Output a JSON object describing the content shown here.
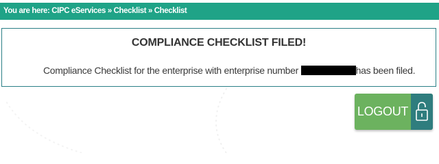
{
  "breadcrumb": {
    "prefix": "You are here:",
    "items": [
      "CIPC eServices",
      "Checklist",
      "Checklist"
    ],
    "separator": "»"
  },
  "panel": {
    "title": "COMPLIANCE CHECKLIST FILED!",
    "message_before": "Compliance Checklist for the enterprise with enterprise number",
    "message_after": "has been filed."
  },
  "logout": {
    "label": "LOGOUT",
    "icon": "lock-icon"
  },
  "colors": {
    "breadcrumb_bg": "#1fa387",
    "panel_border": "#2a7f86",
    "logout_bg": "#6cb25f",
    "lock_bg": "#2f7d7e"
  }
}
